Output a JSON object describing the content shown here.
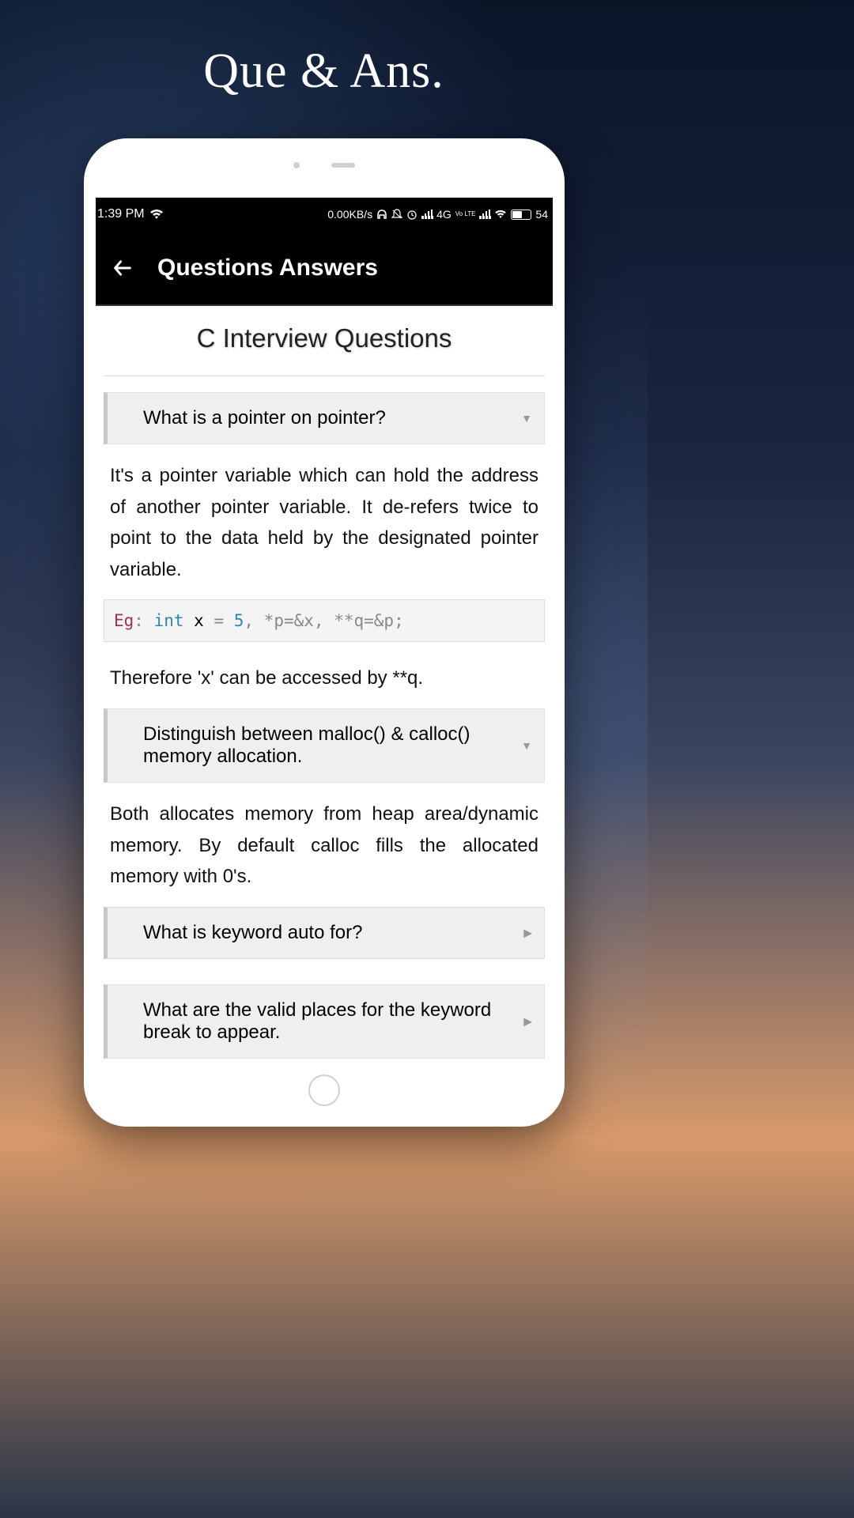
{
  "page": {
    "header_title": "Que & Ans."
  },
  "status_bar": {
    "time": "1:39 PM",
    "data_rate": "0.00KB/s",
    "network": "4G",
    "lte_label": "Vo LTE",
    "battery": "54"
  },
  "app_bar": {
    "title": "Questions Answers"
  },
  "content": {
    "section_title": "C Interview Questions",
    "q1": {
      "question": "What is a pointer on pointer?",
      "answer1": "It's a pointer variable which can hold the address of another pointer variable. It de-refers twice to point to the data held by the designated pointer variable.",
      "code_eg": "Eg",
      "code_colon": ": ",
      "code_int": "int",
      "code_rest1": " x ",
      "code_eq": "=",
      "code_num": " 5",
      "code_rest2": ", *p=&x, **q=&p;",
      "answer2": "Therefore 'x' can be accessed by **q."
    },
    "q2": {
      "question": "Distinguish between malloc() & calloc() memory allocation.",
      "answer": "Both allocates memory from heap area/dynamic memory. By default calloc fills the allocated memory with 0's."
    },
    "q3": {
      "question": "What is keyword auto for?"
    },
    "q4": {
      "question": "What are the valid places for the keyword break to appear."
    }
  }
}
